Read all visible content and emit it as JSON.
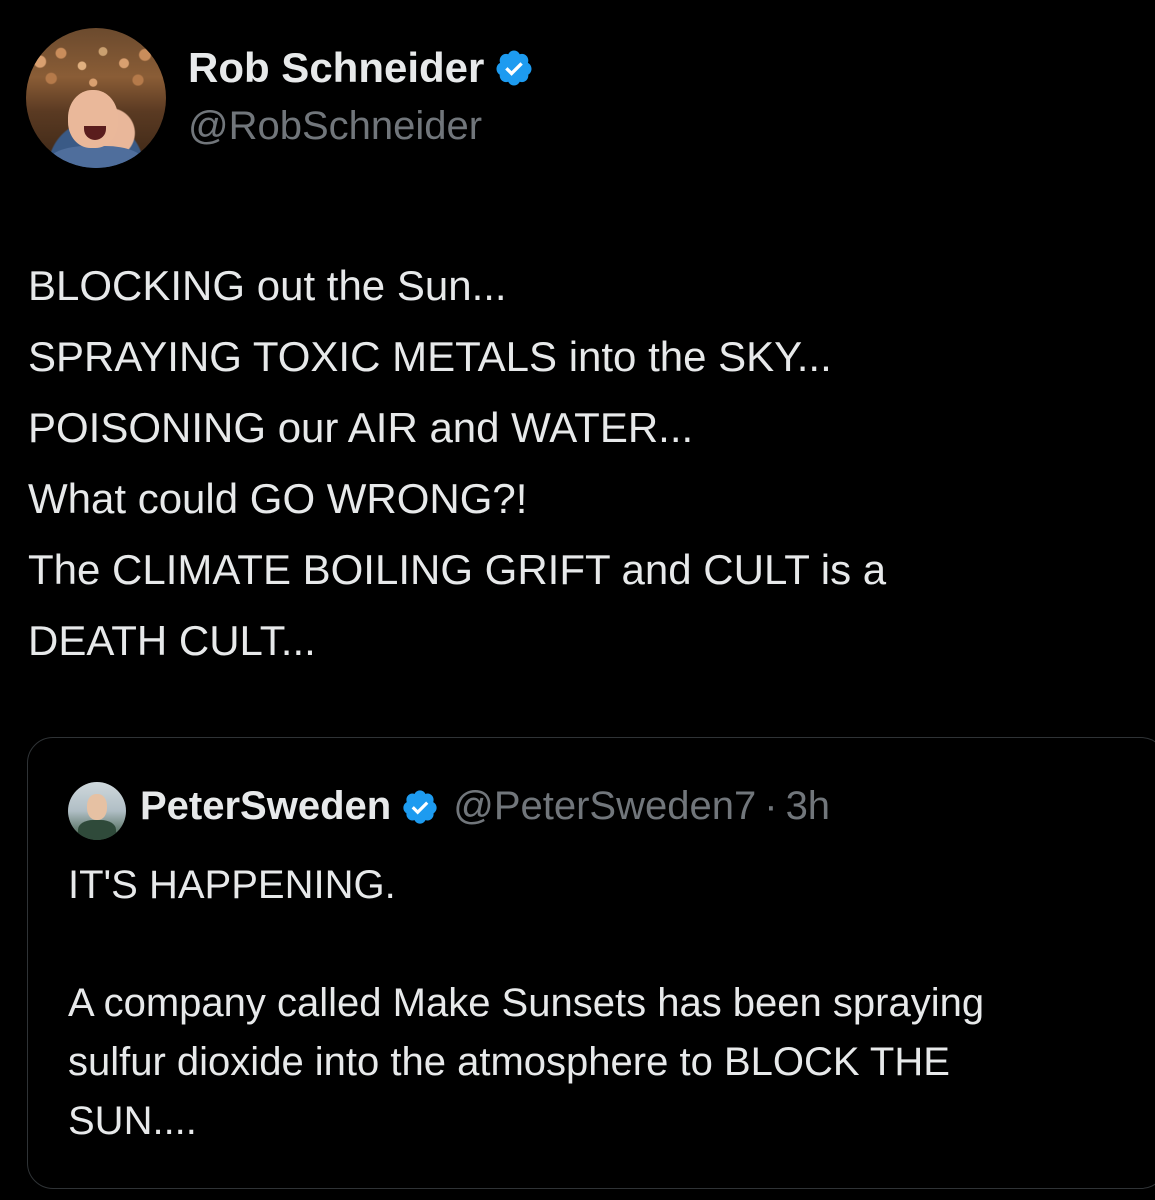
{
  "tweet": {
    "author": {
      "name": "Rob Schneider",
      "handle": "@RobSchneider",
      "verified": true,
      "avatar_icon": "profile-photo"
    },
    "body_lines": [
      "BLOCKING out the Sun...",
      "SPRAYING TOXIC METALS into the SKY...",
      "POISONING our AIR and WATER...",
      "What could GO WRONG?!",
      "The CLIMATE BOILING GRIFT and CULT is a",
      "DEATH CULT..."
    ]
  },
  "quoted_tweet": {
    "author": {
      "name": "PeterSweden",
      "handle": "@PeterSweden7",
      "verified": true,
      "avatar_icon": "profile-photo"
    },
    "separator": "·",
    "time": "3h",
    "text_lines": [
      "IT'S HAPPENING.",
      "",
      "A company called Make Sunsets has been spraying",
      "sulfur dioxide into the atmosphere to BLOCK THE",
      "SUN...."
    ]
  },
  "colors": {
    "background": "#000000",
    "primary_text": "#e7e9ea",
    "secondary_text": "#71767b",
    "verified_badge": "#1d9bf0",
    "border": "#2f3336"
  }
}
